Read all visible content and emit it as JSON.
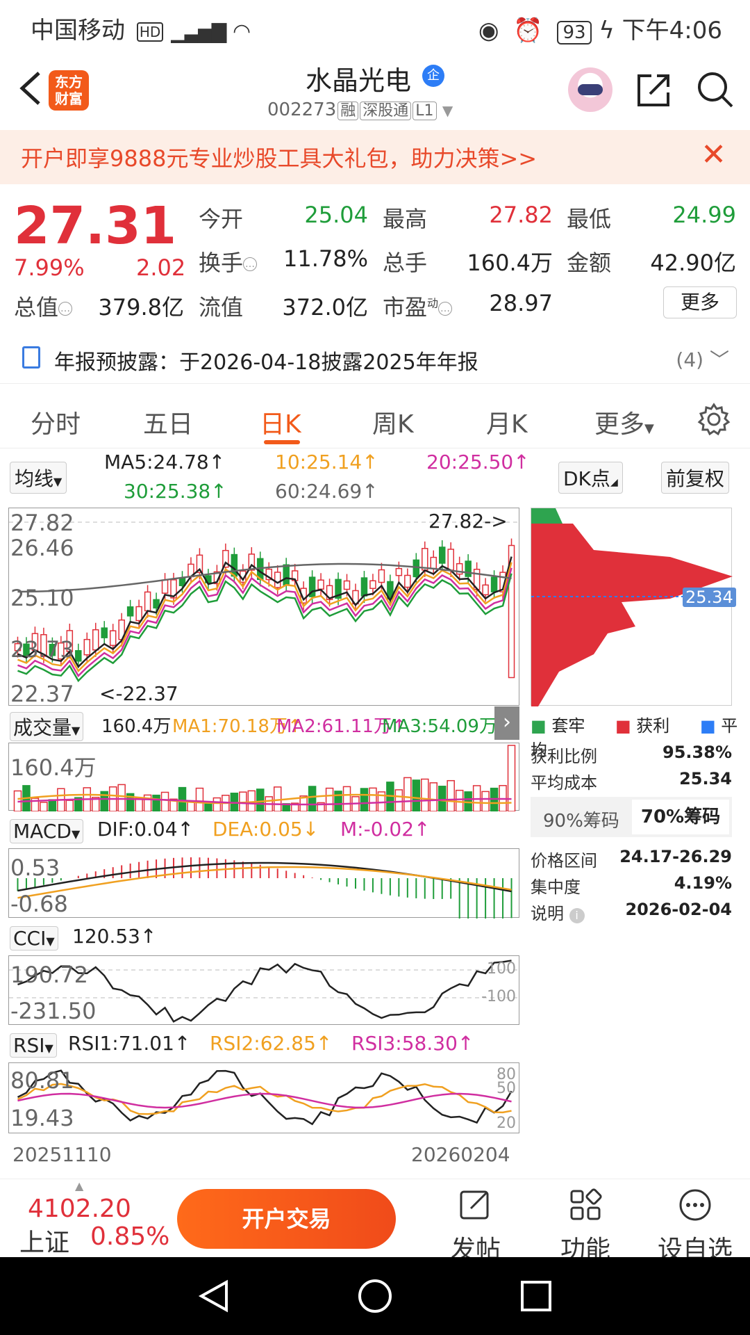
{
  "status": {
    "carrier": "中国移动",
    "battery": "93",
    "time": "下午4:06"
  },
  "header": {
    "logo": "东方财富",
    "title": "水晶光电",
    "title_badge": "企",
    "code": "002273",
    "tags": [
      "融",
      "深股通",
      "L1"
    ]
  },
  "promo": {
    "text": "开户即享9888元专业炒股工具大礼包，助力决策>>"
  },
  "quote": {
    "price": "27.31",
    "change_pct": "7.99%",
    "change": "2.02",
    "open_label": "今开",
    "open": "25.04",
    "high_label": "最高",
    "high": "27.82",
    "low_label": "最低",
    "low": "24.99",
    "turnover_label": "换手",
    "turnover": "11.78%",
    "volume_label": "总手",
    "volume": "160.4万",
    "amount_label": "金额",
    "amount": "42.90亿",
    "mcap_label": "总值",
    "mcap": "379.8亿",
    "float_label": "流值",
    "float": "372.0亿",
    "pe_label": "市盈",
    "pe_sup": "动",
    "pe": "28.97",
    "more": "更多"
  },
  "annual": {
    "text": "年报预披露：于2026-04-18披露2025年年报",
    "count": "(4)"
  },
  "tabs": [
    "分时",
    "五日",
    "日K",
    "周K",
    "月K",
    "更多"
  ],
  "kline": {
    "ma_selector": "均线",
    "ma5": "MA5:24.78↑",
    "ma10": "10:25.14↑",
    "ma20": "20:25.50↑",
    "ma30": "30:25.38↑",
    "ma60": "60:24.69↑",
    "dk_button": "DK点",
    "adjust_button": "前复权",
    "axis_top": "27.82",
    "axis_mid": "26.46",
    "axis_low": "25.10",
    "axis_b1": "23.73",
    "axis_bottom": "22.37",
    "high_marker": "27.82->",
    "low_marker": "<-22.37"
  },
  "volume": {
    "selector": "成交量",
    "vol": "160.4万",
    "ma1": "MA1:70.18万↑",
    "ma2": "MA2:61.11万↑",
    "ma3": "MA3:54.09万↑",
    "axis_top": "160.4万"
  },
  "macd": {
    "selector": "MACD",
    "dif": "DIF:0.04↑",
    "dea": "DEA:0.05↓",
    "m": "M:-0.02↑",
    "axis_top": "0.53",
    "axis_bottom": "-0.68"
  },
  "cci": {
    "selector": "CCI",
    "value": "120.53↑",
    "axis_top": "190.72",
    "axis_bottom": "-231.50",
    "ref_hi": "100",
    "ref_lo": "-100"
  },
  "rsi": {
    "selector": "RSI",
    "rsi1": "RSI1:71.01↑",
    "rsi2": "RSI2:62.85↑",
    "rsi3": "RSI3:58.30↑",
    "axis_top": "80.81",
    "axis_bottom": "19.43",
    "ref_hi": "80",
    "ref_mid": "50",
    "ref_lo": "20"
  },
  "dates": {
    "start": "20251110",
    "end": "20260204"
  },
  "chips": {
    "legend": [
      "套牢",
      "获利",
      "平均"
    ],
    "avg_label": "25.34",
    "profit_ratio_label": "获利比例",
    "profit_ratio": "95.38%",
    "avg_cost_label": "平均成本",
    "avg_cost": "25.34",
    "tab90": "90%筹码",
    "tab70": "70%筹码",
    "range_label": "价格区间",
    "range": "24.17-26.29",
    "concentration_label": "集中度",
    "concentration": "4.19%",
    "note_label": "说明",
    "note": "2026-02-04"
  },
  "bottom": {
    "index_value": "4102.20",
    "index_name": "上证",
    "index_pct": "0.85%",
    "trade_button": "开户交易",
    "post": "发帖",
    "functions": "功能",
    "watchlist": "设自选"
  },
  "colors": {
    "up": "#e0303a",
    "down": "#1f9d3a",
    "accent": "#f25a1a",
    "ma5": "#222222",
    "ma10": "#f0a020",
    "ma20": "#d02ea0",
    "ma30": "#1f9d3a",
    "ma60": "#666666"
  }
}
